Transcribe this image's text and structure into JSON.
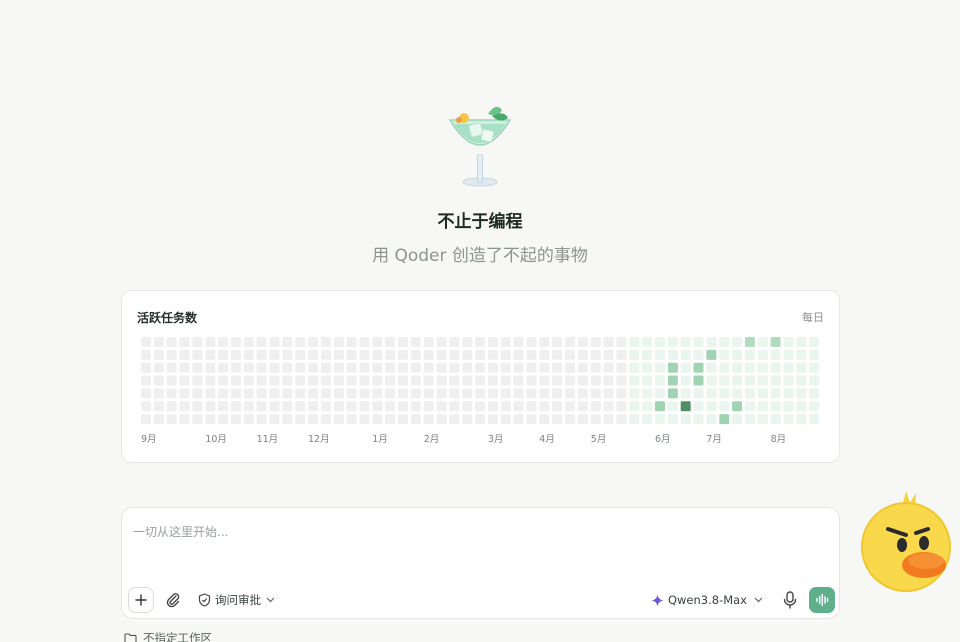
{
  "hero": {
    "title": "不止于编程",
    "subtitle": "用 Qoder 创造了不起的事物"
  },
  "activity": {
    "title": "活跃任务数",
    "range": "每日"
  },
  "chart_data": {
    "type": "heatmap",
    "title": "活跃任务数",
    "rows": 7,
    "columns": 53,
    "month_labels": [
      {
        "label": "9月",
        "week": 0
      },
      {
        "label": "10月",
        "week": 5
      },
      {
        "label": "11月",
        "week": 9
      },
      {
        "label": "12月",
        "week": 13
      },
      {
        "label": "1月",
        "week": 18
      },
      {
        "label": "2月",
        "week": 22
      },
      {
        "label": "3月",
        "week": 27
      },
      {
        "label": "4月",
        "week": 31
      },
      {
        "label": "5月",
        "week": 35
      },
      {
        "label": "6月",
        "week": 40
      },
      {
        "label": "7月",
        "week": 44
      },
      {
        "label": "8月",
        "week": 49
      }
    ],
    "colors": {
      "empty": "#efefef",
      "tint": "#e9f5ee",
      "level1": "#9fd3b1",
      "level2": "#b2dcc1",
      "level3": "#4e8f63"
    },
    "tinted_from_week": 38,
    "tinted_until_week": 53,
    "active_cells": [
      {
        "week": 47,
        "day": 0,
        "level": 2
      },
      {
        "week": 49,
        "day": 0,
        "level": 2
      },
      {
        "week": 44,
        "day": 1,
        "level": 1
      },
      {
        "week": 41,
        "day": 2,
        "level": 1
      },
      {
        "week": 43,
        "day": 2,
        "level": 1
      },
      {
        "week": 41,
        "day": 3,
        "level": 1
      },
      {
        "week": 43,
        "day": 3,
        "level": 1
      },
      {
        "week": 41,
        "day": 4,
        "level": 1
      },
      {
        "week": 40,
        "day": 5,
        "level": 1
      },
      {
        "week": 42,
        "day": 5,
        "level": 3
      },
      {
        "week": 46,
        "day": 5,
        "level": 1
      },
      {
        "week": 45,
        "day": 6,
        "level": 1
      }
    ]
  },
  "composer": {
    "placeholder": "一切从这里开始...",
    "mode_label": "询问审批",
    "model_label": "Qwen3.8-Max"
  },
  "workspace": {
    "label": "不指定工作区"
  },
  "icons": {
    "hero": "cocktail-glass-icon",
    "add": "plus-icon",
    "attach": "paperclip-icon",
    "mode": "shield-icon",
    "model": "sparkle-icon",
    "mic": "microphone-icon",
    "voice": "voice-wave-icon",
    "folder": "folder-icon",
    "mascot": "duck-mascot-icon"
  }
}
